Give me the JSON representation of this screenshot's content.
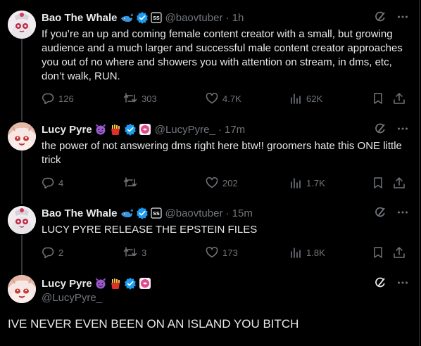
{
  "tweets": [
    {
      "name": "Bao The Whale",
      "handle": "@baovtuber",
      "time": "· 1h",
      "text": "If you’re an up and coming female content creator with a small, but growing audience and a much larger and successful male content creator approaches you out of no where and showers you with attention on stream, in dms, etc, don’t walk, RUN.",
      "replies": "126",
      "reposts": "303",
      "likes": "4.7K",
      "views": "62K"
    },
    {
      "name": "Lucy Pyre",
      "handle": "@LucyPyre_",
      "time": "· 17m",
      "text": "the power of not answering dms right here btw!! groomers hate this ONE little trick",
      "replies": "4",
      "reposts": "",
      "likes": "202",
      "views": "1.7K"
    },
    {
      "name": "Bao The Whale",
      "handle": "@baovtuber",
      "time": "· 15m",
      "text": "LUCY PYRE RELEASE THE EPSTEIN FILES",
      "replies": "2",
      "reposts": "3",
      "likes": "173",
      "views": "1.8K"
    }
  ],
  "main": {
    "name": "Lucy Pyre",
    "handle": "@LucyPyre_",
    "text": "IVE NEVER EVEN BEEN ON AN ISLAND YOU BITCH"
  },
  "icons": {
    "verified": "verified-badge-icon",
    "grok": "grok-icon",
    "more": "more-icon",
    "reply": "reply-icon",
    "repost": "repost-icon",
    "like": "like-icon",
    "views": "views-icon",
    "bookmark": "bookmark-icon",
    "share": "share-icon"
  },
  "colors": {
    "background": "#000000",
    "text": "#e7e9ea",
    "muted": "#71767b",
    "verified": "#1d9bf0",
    "divider": "#2f3336"
  }
}
